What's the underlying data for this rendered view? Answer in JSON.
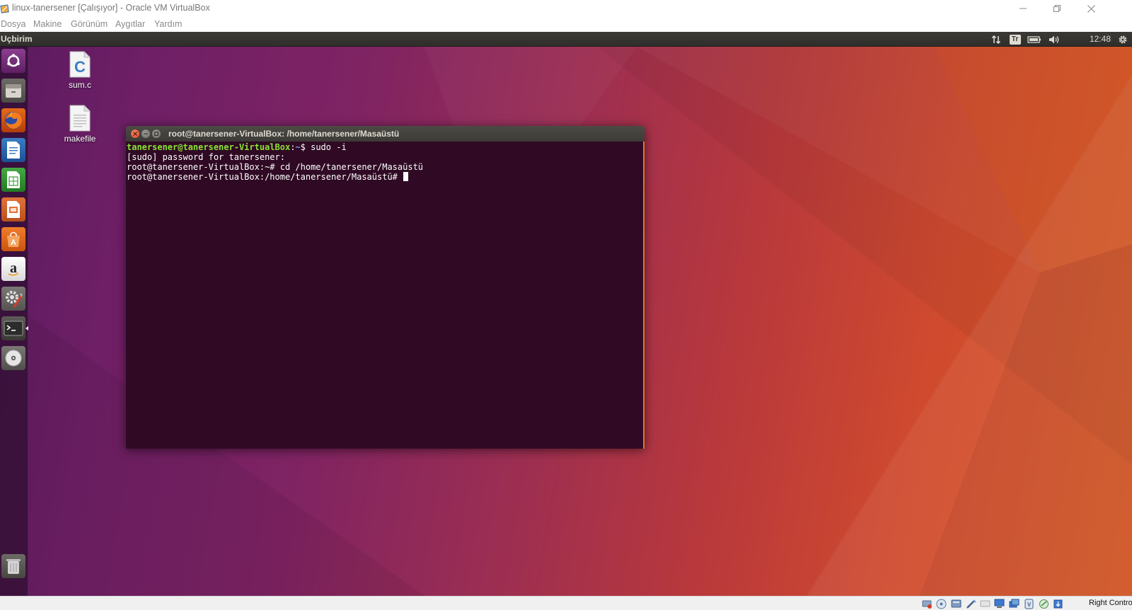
{
  "host_window": {
    "title": "linux-tanersener [Çalışıyor] - Oracle VM VirtualBox",
    "menu": [
      "Dosya",
      "Makine",
      "Görünüm",
      "Aygıtlar",
      "Yardım"
    ]
  },
  "guest": {
    "top_panel": {
      "title": "Uçbirim",
      "keyboard_layout": "Tr",
      "clock": "12:48",
      "tray_icons": [
        "network-updown-icon",
        "keyboard-layout-icon",
        "battery-icon",
        "volume-icon",
        "gear-icon"
      ]
    },
    "launcher": {
      "items": [
        "ubuntu-dash-icon",
        "files-icon",
        "firefox-icon",
        "libreoffice-writer-icon",
        "libreoffice-calc-icon",
        "libreoffice-impress-icon",
        "software-center-icon",
        "amazon-icon",
        "system-settings-icon",
        "terminal-icon",
        "dvd-icon"
      ],
      "bottom_item": "trash-icon"
    },
    "desktop_icons": [
      {
        "label": "sum.c",
        "icon": "c-source-file-icon"
      },
      {
        "label": "makefile",
        "icon": "text-file-icon"
      }
    ],
    "terminal": {
      "title": "root@tanersener-VirtualBox: /home/tanersener/Masaüstü",
      "lines": {
        "l1_user": "tanersener@tanersener-VirtualBox",
        "l1_sep": ":",
        "l1_path": "~",
        "l1_cmd": "$ sudo -i",
        "l2": "[sudo] password for tanersener:",
        "l3": "root@tanersener-VirtualBox:~# cd /home/tanersener/Masaüstü",
        "l4": "root@tanersener-VirtualBox:/home/tanersener/Masaüstü# "
      },
      "colors": {
        "background": "#300a24",
        "user": "#8ae234",
        "path": "#729fcf"
      }
    }
  },
  "status_bar": {
    "icons": [
      "hard-disk-icon",
      "optical-drive-icon",
      "audio-icon",
      "network-icon",
      "usb-icon",
      "shared-folders-icon",
      "display-icon",
      "video-capture-icon",
      "recording-icon",
      "cpu-icon",
      "mouse-integration-icon"
    ],
    "host_key": "Right Control"
  }
}
